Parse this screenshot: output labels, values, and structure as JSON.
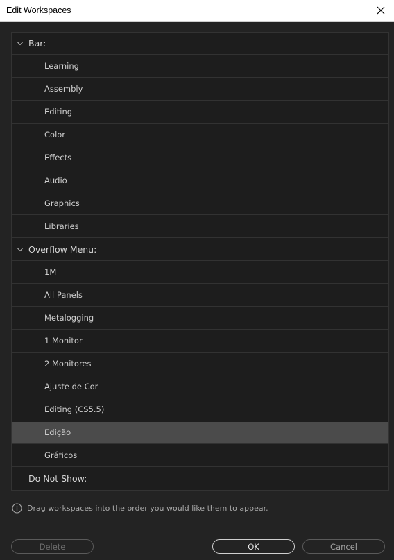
{
  "window": {
    "title": "Edit Workspaces"
  },
  "groups": [
    {
      "label": "Bar:",
      "items": [
        "Learning",
        "Assembly",
        "Editing",
        "Color",
        "Effects",
        "Audio",
        "Graphics",
        "Libraries"
      ]
    },
    {
      "label": "Overflow Menu:",
      "items": [
        "1M",
        "All Panels",
        "Metalogging",
        "1 Monitor",
        "2 Monitores",
        "Ajuste de Cor",
        "Editing (CS5.5)",
        "Edição",
        "Gráficos"
      ]
    },
    {
      "label": "Do Not Show:",
      "items": []
    }
  ],
  "selected_item": "Edição",
  "hint": "Drag workspaces into the order you would like them to appear.",
  "buttons": {
    "delete": "Delete",
    "ok": "OK",
    "cancel": "Cancel"
  },
  "colors": {
    "background": "#232323",
    "selected_row": "#4b4b4b"
  }
}
